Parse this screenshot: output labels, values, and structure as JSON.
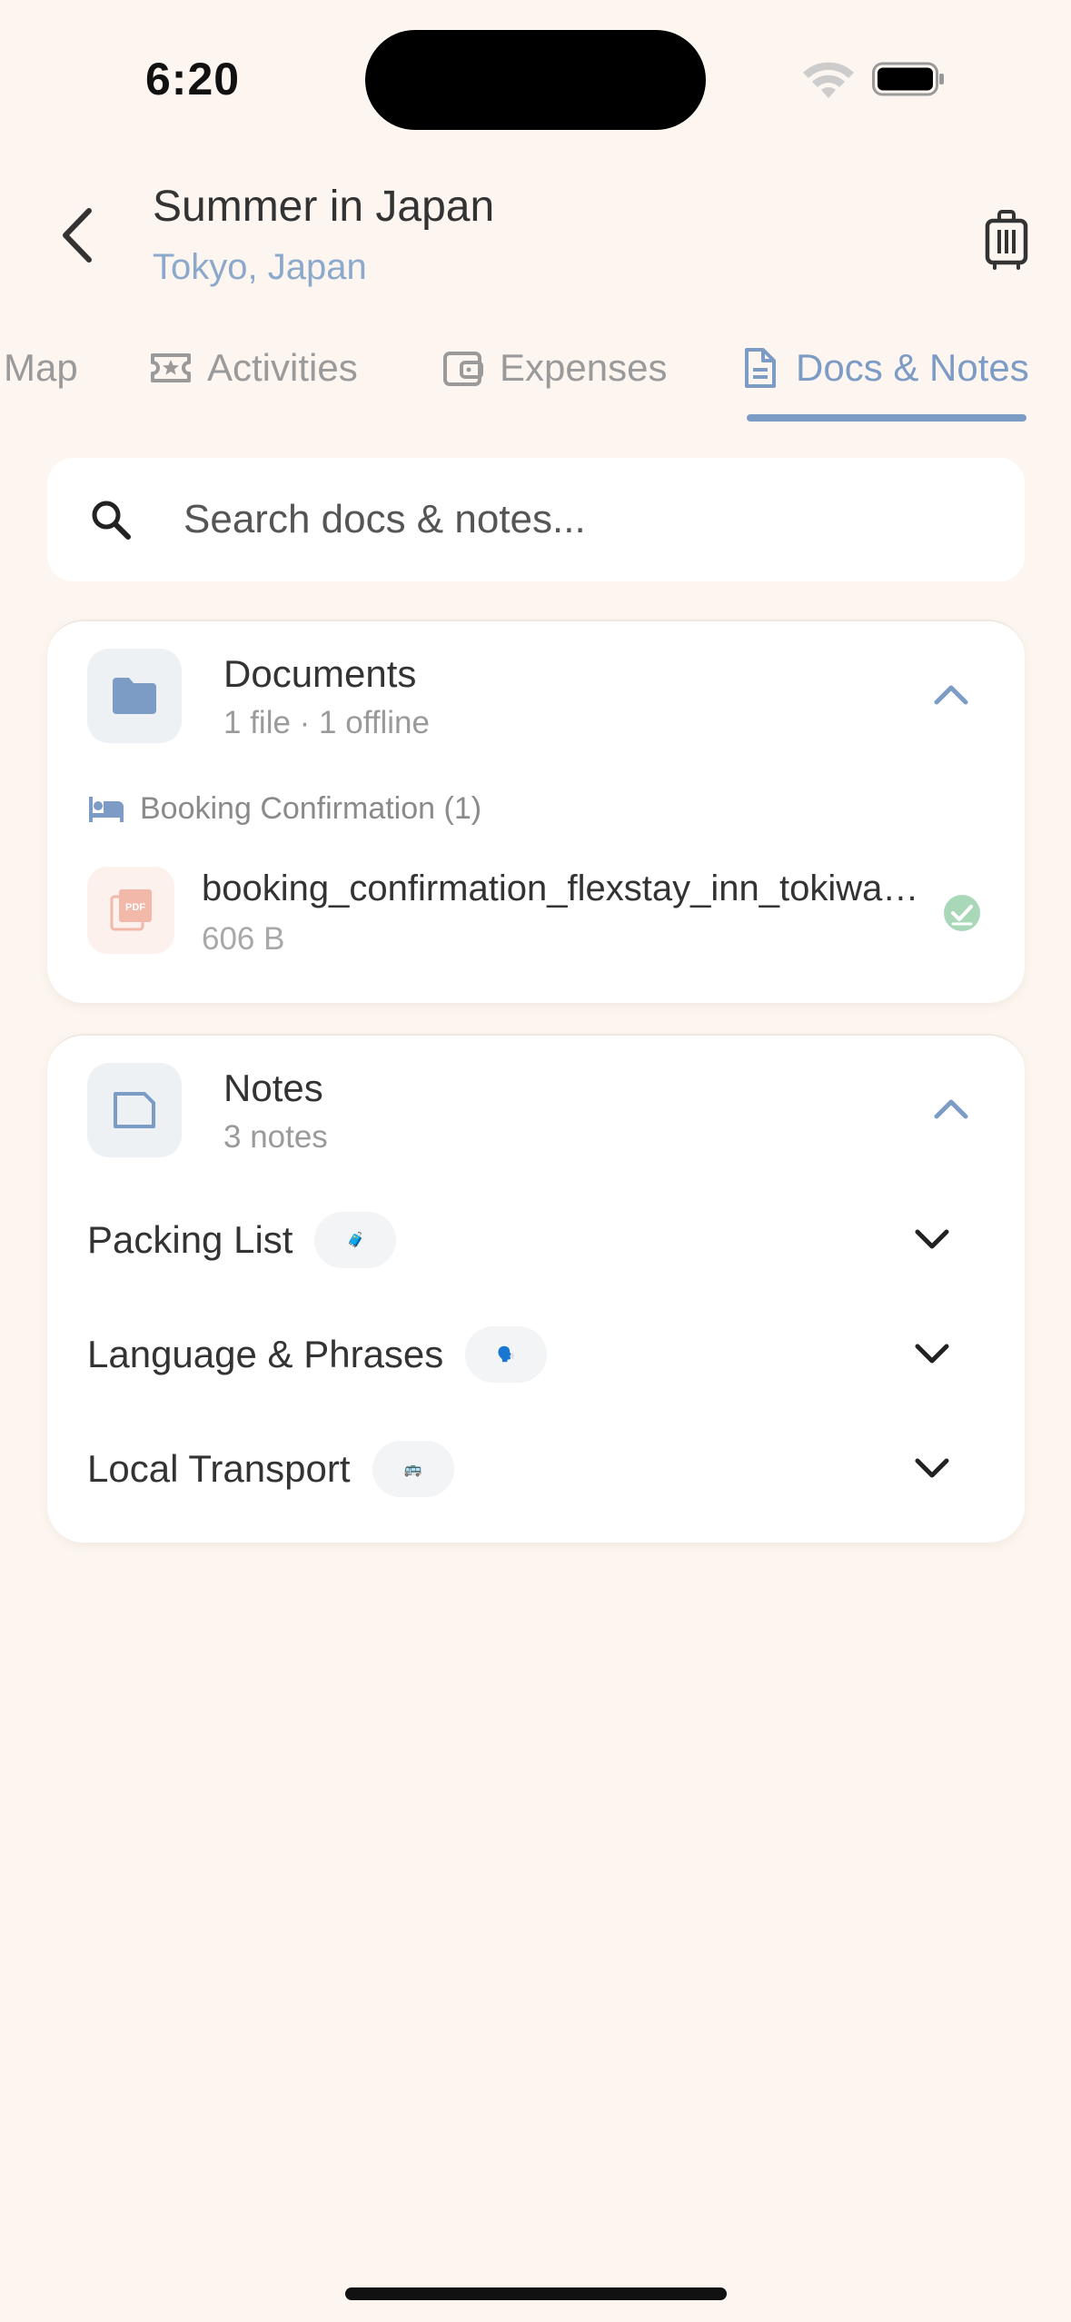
{
  "status_bar": {
    "time": "6:20"
  },
  "header": {
    "title": "Summer in Japan",
    "subtitle": "Tokyo, Japan"
  },
  "tabs": [
    {
      "label": "Map",
      "icon": "map-icon"
    },
    {
      "label": "Activities",
      "icon": "ticket-star-icon"
    },
    {
      "label": "Expenses",
      "icon": "wallet-icon"
    },
    {
      "label": "Docs & Notes",
      "icon": "document-icon",
      "active": true
    }
  ],
  "search": {
    "placeholder": "Search docs & notes..."
  },
  "documents": {
    "title": "Documents",
    "subtitle": "1 file · 1 offline",
    "groups": [
      {
        "label": "Booking Confirmation (1)",
        "icon": "bed-icon",
        "files": [
          {
            "name": "booking_confirmation_flexstay_inn_tokiwadai.pdf",
            "size": "606 B",
            "icon": "pdf-icon",
            "offline": true
          }
        ]
      }
    ]
  },
  "notes": {
    "title": "Notes",
    "subtitle": "3 notes",
    "items": [
      {
        "title": "Packing List",
        "emoji": "🧳"
      },
      {
        "title": "Language & Phrases",
        "emoji": "🗣️"
      },
      {
        "title": "Local Transport",
        "emoji": "🚌"
      }
    ]
  },
  "colors": {
    "background": "#FDF6F0",
    "accent": "#7C9BC5",
    "card": "#FFFFFF",
    "offline_green": "#A8D8B8",
    "pdf_tint": "#F2B8AA"
  }
}
